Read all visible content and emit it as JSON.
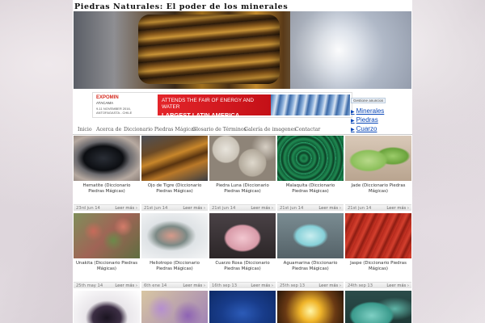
{
  "site": {
    "title": "Piedras Naturales: El poder de los minerales"
  },
  "ad": {
    "logo_line1": "EXPOMIN",
    "logo_line2": "ATACAMA",
    "logo_line3": "9-11 NOVEMBER 2016, ANTOFAGASTA - CHILE",
    "banner_line1": "ATTENDS THE FAIR OF ENERGY AND WATER",
    "banner_line2": "LARGEST LATIN AMERICA",
    "choices_label": "Gestione anuncios",
    "links": [
      "Minerales",
      "Piedras",
      "Cuarzo"
    ]
  },
  "nav": [
    "Inicio",
    "Acerca de",
    "Diccionario Piedras Mágicas",
    "Glosario de Términos",
    "Galería de imagenes",
    "Contactar"
  ],
  "cards": [
    {
      "name": "Hematite (Diccionario Piedras Mágicas)",
      "date": "23rd jun 14",
      "more": "Leer más"
    },
    {
      "name": "Ojo de Tigre (Diccionario Piedras Mágicas)",
      "date": "21st jun 14",
      "more": "Leer más"
    },
    {
      "name": "Piedra Luna (Diccionario Piedras Mágicas)",
      "date": "21st jun 14",
      "more": "Leer más"
    },
    {
      "name": "Malaquita (Diccionario Piedras Mágicas)",
      "date": "21st jun 14",
      "more": "Leer más"
    },
    {
      "name": "Jade (Diccionario Piedras Mágicas)",
      "date": "21st jun 14",
      "more": "Leer más"
    },
    {
      "name": "Unakita (Diccionario Piedras Mágicas)",
      "date": "25th may 14",
      "more": "Leer más"
    },
    {
      "name": "Heliotropo (Diccionario Piedras Mágicas)",
      "date": "6th ene 14",
      "more": "Leer más"
    },
    {
      "name": "Cuarzo Rosa (Diccionario Piedras Mágicas)",
      "date": "16th sep 13",
      "more": "Leer más"
    },
    {
      "name": "Aguamarina (Diccionario Piedras Mágicas)",
      "date": "25th sep 13",
      "more": "Leer más"
    },
    {
      "name": "Jaspe (Diccionario Piedras Mágicas)",
      "date": "24th sep 13",
      "more": "Leer más"
    }
  ],
  "colors": {
    "link": "#0a47b8",
    "ad_red": "#e4252a"
  }
}
